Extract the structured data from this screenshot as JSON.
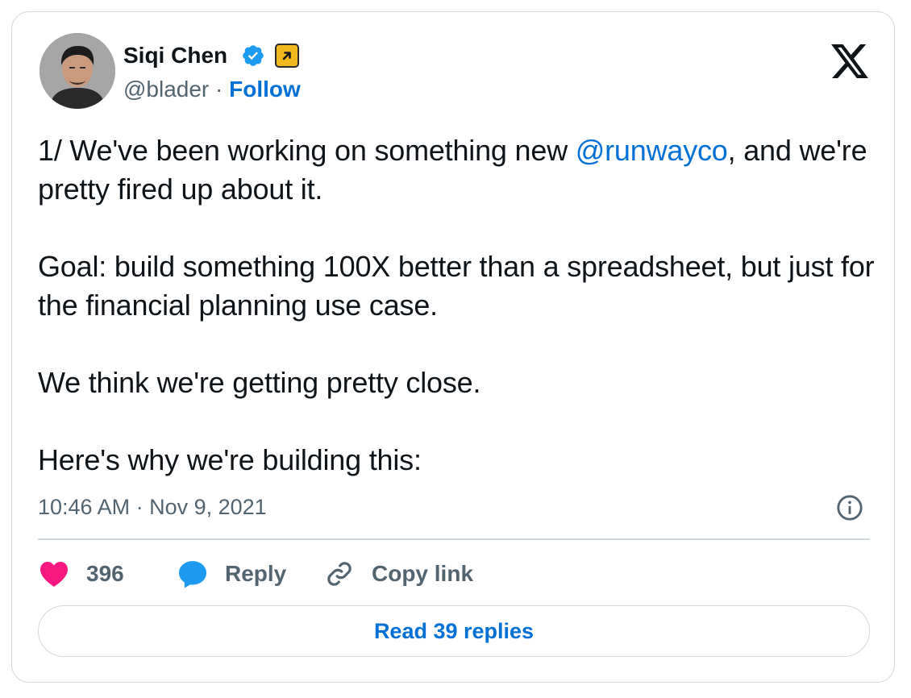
{
  "author": {
    "name": "Siqi Chen",
    "handle": "@blader",
    "separator": "·",
    "follow_label": "Follow",
    "avatar_icon": "user-avatar-photo",
    "verified_icon": "verified-badge-icon",
    "affiliation_icon": "affiliate-badge-icon"
  },
  "tweet": {
    "line1_prefix": "1/ We've been working on something new ",
    "mention": "@runwayco",
    "line1_suffix": ", and we're pretty fired up about it.",
    "para2": "Goal: build something 100X better than a spreadsheet, but just for the financial planning use case.",
    "para3": "We think we're getting pretty close.",
    "para4": "Here's why we're building this:"
  },
  "meta": {
    "timestamp": "10:46 AM · Nov 9, 2021"
  },
  "actions": {
    "like_count": "396",
    "reply_label": "Reply",
    "copy_link_label": "Copy link"
  },
  "read_replies_label": "Read 39 replies",
  "colors": {
    "accent": "#006fd6",
    "like": "#f91880",
    "reply": "#1d9bf0",
    "verified": "#1d9bf0",
    "affiliate": "#f3b81d",
    "muted": "#536471",
    "border": "#cfd9de"
  }
}
